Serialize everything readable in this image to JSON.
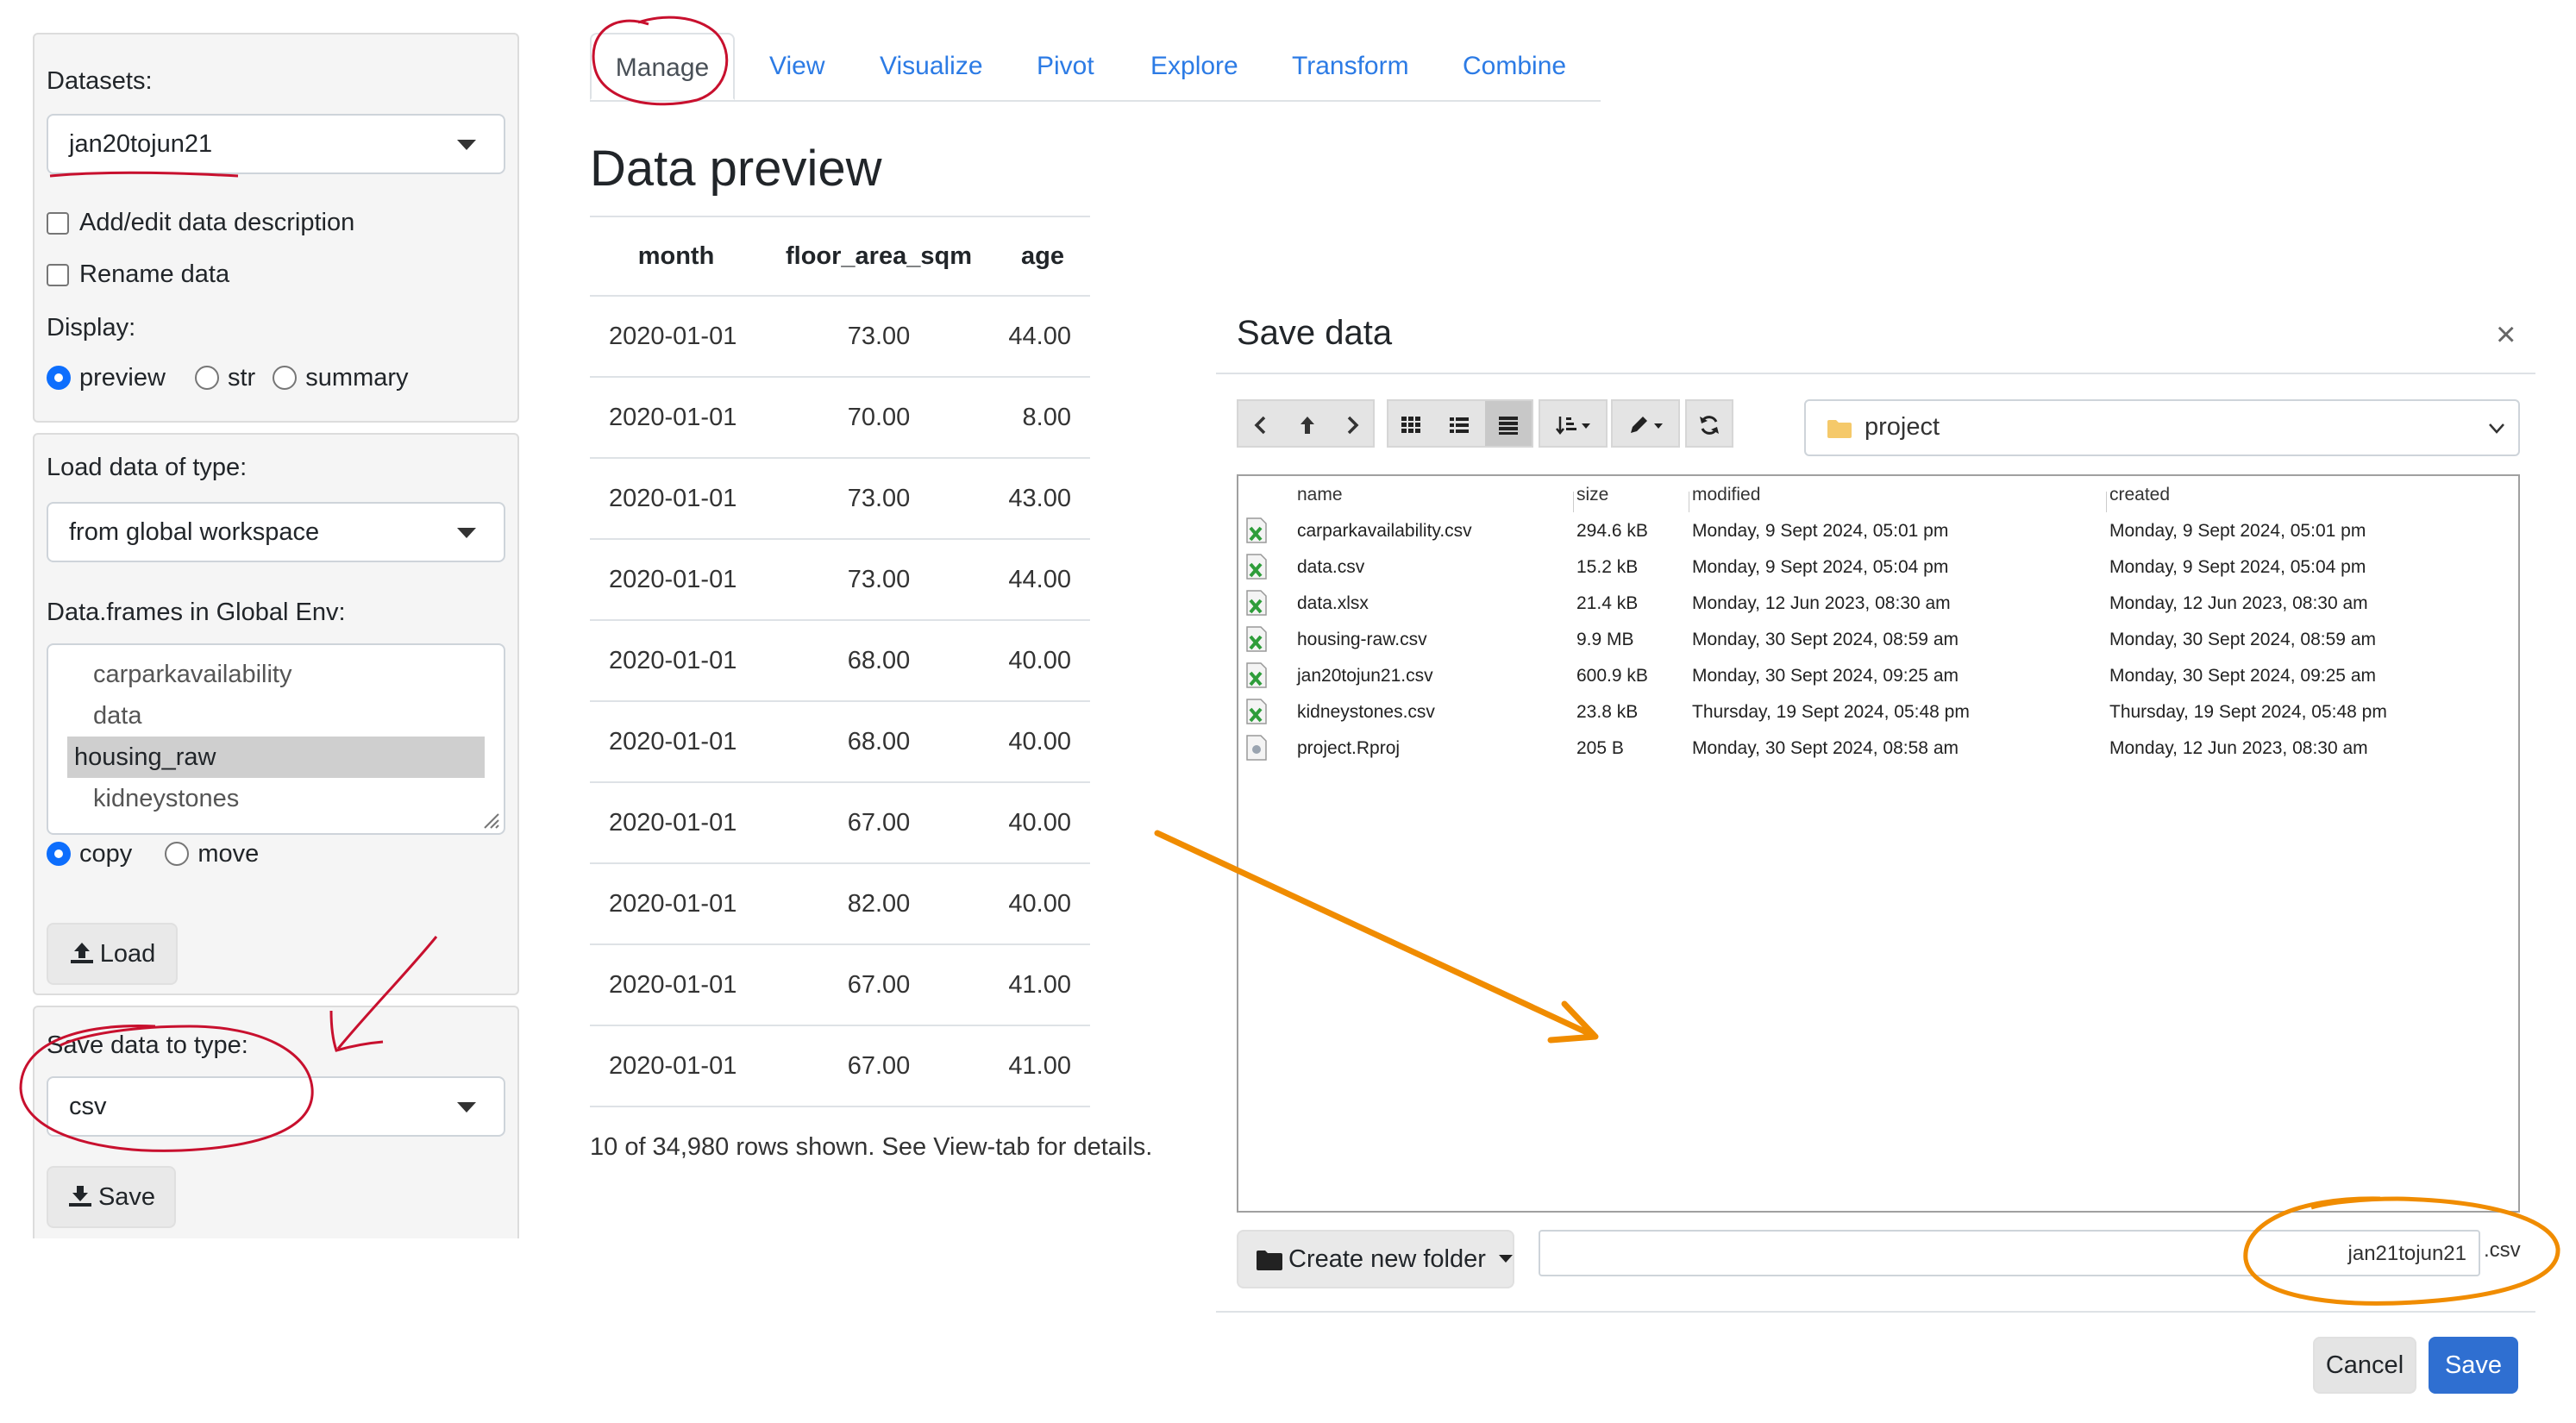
{
  "sidebar": {
    "datasets_label": "Datasets:",
    "dataset_selected": "jan20tojun21",
    "add_desc_label": "Add/edit data description",
    "rename_label": "Rename data",
    "display_label": "Display:",
    "display_options": [
      "preview",
      "str",
      "summary"
    ],
    "display_selected": "preview",
    "load_type_label": "Load data of type:",
    "load_type_selected": "from global workspace",
    "global_env_label": "Data.frames in Global Env:",
    "global_env_items": [
      "carparkavailability",
      "data",
      "housing_raw",
      "kidneystones"
    ],
    "global_env_selected": "housing_raw",
    "copy_move_options": [
      "copy",
      "move"
    ],
    "copy_move_selected": "copy",
    "load_button": "Load",
    "save_type_label": "Save data to type:",
    "save_type_selected": "csv",
    "save_button": "Save"
  },
  "tabs": [
    "Manage",
    "View",
    "Visualize",
    "Pivot",
    "Explore",
    "Transform",
    "Combine"
  ],
  "active_tab": "Manage",
  "preview": {
    "title": "Data preview",
    "columns": [
      "month",
      "floor_area_sqm",
      "age"
    ],
    "rows": [
      [
        "2020-01-01",
        "73.00",
        "44.00"
      ],
      [
        "2020-01-01",
        "70.00",
        "8.00"
      ],
      [
        "2020-01-01",
        "73.00",
        "43.00"
      ],
      [
        "2020-01-01",
        "73.00",
        "44.00"
      ],
      [
        "2020-01-01",
        "68.00",
        "40.00"
      ],
      [
        "2020-01-01",
        "68.00",
        "40.00"
      ],
      [
        "2020-01-01",
        "67.00",
        "40.00"
      ],
      [
        "2020-01-01",
        "82.00",
        "40.00"
      ],
      [
        "2020-01-01",
        "67.00",
        "41.00"
      ],
      [
        "2020-01-01",
        "67.00",
        "41.00"
      ]
    ],
    "footer": "10 of 34,980 rows shown. See View-tab for details."
  },
  "modal": {
    "title": "Save data",
    "close": "×",
    "folder": "project",
    "file_columns": [
      "name",
      "size",
      "modified",
      "created"
    ],
    "files": [
      {
        "name": "carparkavailability.csv",
        "size": "294.6 kB",
        "modified": "Monday, 9 Sept 2024, 05:01 pm",
        "created": "Monday, 9 Sept 2024, 05:01 pm",
        "kind": "csv"
      },
      {
        "name": "data.csv",
        "size": "15.2 kB",
        "modified": "Monday, 9 Sept 2024, 05:04 pm",
        "created": "Monday, 9 Sept 2024, 05:04 pm",
        "kind": "csv"
      },
      {
        "name": "data.xlsx",
        "size": "21.4 kB",
        "modified": "Monday, 12 Jun 2023, 08:30 am",
        "created": "Monday, 12 Jun 2023, 08:30 am",
        "kind": "csv"
      },
      {
        "name": "housing-raw.csv",
        "size": "9.9 MB",
        "modified": "Monday, 30 Sept 2024, 08:59 am",
        "created": "Monday, 30 Sept 2024, 08:59 am",
        "kind": "csv"
      },
      {
        "name": "jan20tojun21.csv",
        "size": "600.9 kB",
        "modified": "Monday, 30 Sept 2024, 09:25 am",
        "created": "Monday, 30 Sept 2024, 09:25 am",
        "kind": "csv"
      },
      {
        "name": "kidneystones.csv",
        "size": "23.8 kB",
        "modified": "Thursday, 19 Sept 2024, 05:48 pm",
        "created": "Thursday, 19 Sept 2024, 05:48 pm",
        "kind": "csv"
      },
      {
        "name": "project.Rproj",
        "size": "205 B",
        "modified": "Monday, 30 Sept 2024, 08:58 am",
        "created": "Monday, 12 Jun 2023, 08:30 am",
        "kind": "proj"
      }
    ],
    "create_folder_button": "Create new folder",
    "filename_value": "jan21tojun21",
    "filename_ext": ".csv",
    "cancel_button": "Cancel",
    "save_button": "Save"
  },
  "colors": {
    "link_blue": "#2c7be5",
    "annotation_red": "#c8102e",
    "annotation_orange": "#f08c00",
    "primary_button": "#2f6fd1"
  }
}
